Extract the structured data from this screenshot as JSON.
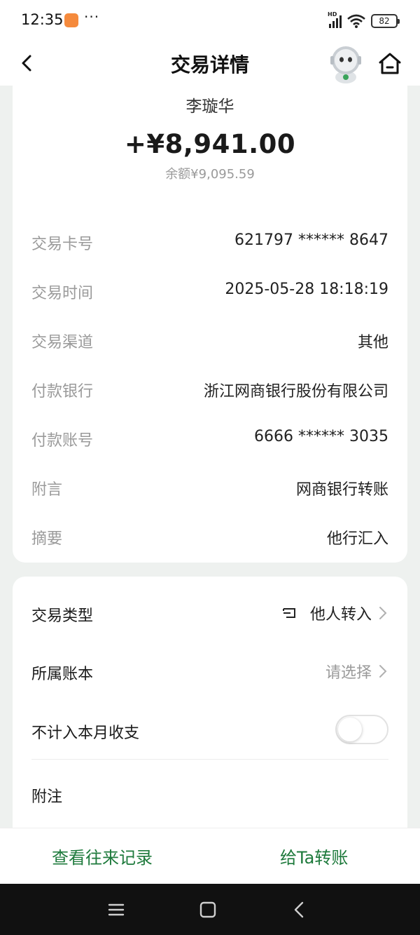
{
  "status_bar": {
    "time": "12:35",
    "dots": "···",
    "network": "HD",
    "battery": "82"
  },
  "nav": {
    "title": "交易详情",
    "back_icon": "chevron-left-icon",
    "home_icon": "home-icon",
    "mascot": "astronaut-mascot"
  },
  "summary": {
    "payer_name": "李璇华",
    "amount": "+¥8,941.00",
    "balance": "余额¥9,095.59"
  },
  "details": [
    {
      "label": "交易卡号",
      "value": "621797 ****** 8647"
    },
    {
      "label": "交易时间",
      "value": "2025-05-28 18:18:19"
    },
    {
      "label": "交易渠道",
      "value": "其他"
    },
    {
      "label": "付款银行",
      "value": "浙江网商银行股份有限公司"
    },
    {
      "label": "付款账号",
      "value": "6666 ****** 3035"
    },
    {
      "label": "附言",
      "value": "网商银行转账"
    },
    {
      "label": "摘要",
      "value": "他行汇入"
    }
  ],
  "options": {
    "type": {
      "label": "交易类型",
      "value": "他人转入",
      "icon": "transfer-in-icon"
    },
    "ledger": {
      "label": "所属账本",
      "placeholder": "请选择"
    },
    "exclude": {
      "label": "不计入本月收支",
      "checked": false
    },
    "note": {
      "label": "附注"
    }
  },
  "bottom_actions": {
    "history": "查看往来记录",
    "transfer": "给Ta转账"
  },
  "colors": {
    "accent": "#1e7a3c",
    "background": "#eef1ef",
    "muted_text": "#9a9a9a"
  }
}
